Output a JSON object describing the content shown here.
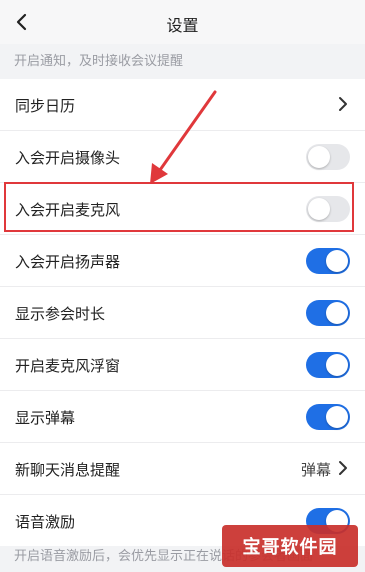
{
  "header": {
    "title": "设置"
  },
  "notes": {
    "top": "开启通知，及时接收会议提醒",
    "bottom": "开启语音激励后，会优先显示正在说话的参会者画面"
  },
  "rows": [
    {
      "label": "同步日历",
      "control": "chevron"
    },
    {
      "label": "入会开启摄像头",
      "control": "toggle",
      "on": false
    },
    {
      "label": "入会开启麦克风",
      "control": "toggle",
      "on": false,
      "highlighted": true
    },
    {
      "label": "入会开启扬声器",
      "control": "toggle",
      "on": true
    },
    {
      "label": "显示参会时长",
      "control": "toggle",
      "on": true
    },
    {
      "label": "开启麦克风浮窗",
      "control": "toggle",
      "on": true
    },
    {
      "label": "显示弹幕",
      "control": "toggle",
      "on": true
    },
    {
      "label": "新聊天消息提醒",
      "control": "chevron",
      "value": "弹幕"
    },
    {
      "label": "语音激励",
      "control": "toggle",
      "on": true
    }
  ],
  "watermark": "宝哥软件园",
  "colors": {
    "toggle_on": "#1f6fe5",
    "toggle_off": "#e6e7ea",
    "annotation": "#e0383b"
  },
  "icons": {
    "back": "chevron-left-icon",
    "row_chevron": "chevron-right-icon"
  }
}
